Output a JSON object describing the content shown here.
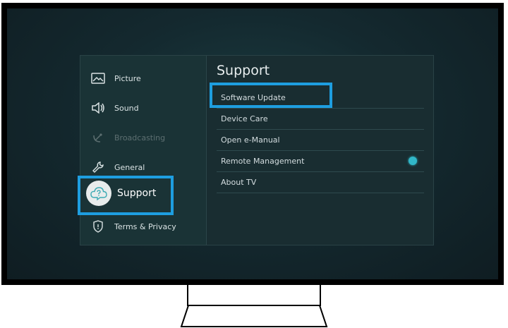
{
  "sidebar": {
    "items": [
      {
        "label": "Picture",
        "icon": "picture-icon",
        "enabled": true
      },
      {
        "label": "Sound",
        "icon": "speaker-icon",
        "enabled": true
      },
      {
        "label": "Broadcasting",
        "icon": "satellite-icon",
        "enabled": false
      },
      {
        "label": "General",
        "icon": "wrench-icon",
        "enabled": true
      },
      {
        "label": "Support",
        "icon": "cloud-question-icon",
        "enabled": true,
        "selected": true
      },
      {
        "label": "Terms & Privacy",
        "icon": "shield-icon",
        "enabled": true
      }
    ]
  },
  "support": {
    "title": "Support",
    "items": [
      {
        "label": "Software Update",
        "focused": true
      },
      {
        "label": "Device Care"
      },
      {
        "label": "Open e-Manual"
      },
      {
        "label": "Remote Management",
        "indicator": "teal-dot"
      },
      {
        "label": "About TV"
      }
    ]
  },
  "colors": {
    "highlight": "#1e9ee0",
    "indicator": "#31b7c8",
    "screen_bg": "#14292f"
  }
}
